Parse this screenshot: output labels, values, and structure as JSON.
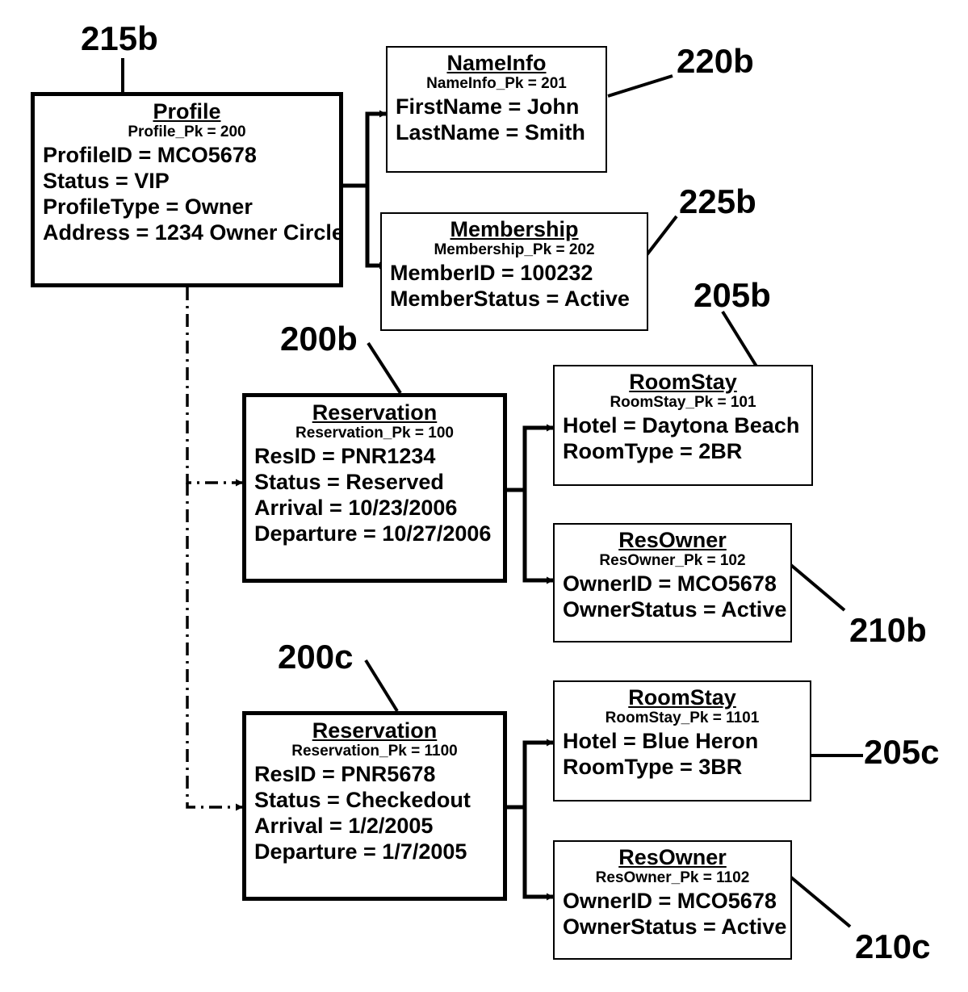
{
  "figure": {
    "type": "entity-relationship-object-diagram",
    "boxes": [
      {
        "id": "profile",
        "ref": "215b",
        "title": "Profile",
        "pk": "Profile_Pk = 200",
        "attrs": [
          "ProfileID = MCO5678",
          "Status = VIP",
          "ProfileType = Owner",
          "Address = 1234 Owner Circle"
        ]
      },
      {
        "id": "nameinfo",
        "ref": "220b",
        "title": "NameInfo",
        "pk": "NameInfo_Pk = 201",
        "attrs": [
          "FirstName = John",
          "LastName = Smith"
        ]
      },
      {
        "id": "membership",
        "ref": "225b",
        "title": "Membership",
        "pk": "Membership_Pk = 202",
        "attrs": [
          "MemberID = 100232",
          "MemberStatus = Active"
        ]
      },
      {
        "id": "reservation-b",
        "ref": "200b",
        "title": "Reservation",
        "pk": "Reservation_Pk = 100",
        "attrs": [
          "ResID = PNR1234",
          "Status = Reserved",
          "Arrival = 10/23/2006",
          "Departure = 10/27/2006"
        ]
      },
      {
        "id": "roomstay-b",
        "ref": "205b",
        "title": "RoomStay",
        "pk": "RoomStay_Pk = 101",
        "attrs": [
          "Hotel = Daytona Beach",
          "RoomType = 2BR"
        ]
      },
      {
        "id": "resowner-b",
        "ref": "210b",
        "title": "ResOwner",
        "pk": "ResOwner_Pk = 102",
        "attrs": [
          "OwnerID = MCO5678",
          "OwnerStatus = Active"
        ]
      },
      {
        "id": "reservation-c",
        "ref": "200c",
        "title": "Reservation",
        "pk": "Reservation_Pk = 1100",
        "attrs": [
          "ResID = PNR5678",
          "Status = Checkedout",
          "Arrival = 1/2/2005",
          "Departure = 1/7/2005"
        ]
      },
      {
        "id": "roomstay-c",
        "ref": "205c",
        "title": "RoomStay",
        "pk": "RoomStay_Pk = 1101",
        "attrs": [
          "Hotel = Blue Heron",
          "RoomType = 3BR"
        ]
      },
      {
        "id": "resowner-c",
        "ref": "210c",
        "title": "ResOwner",
        "pk": "ResOwner_Pk = 1102",
        "attrs": [
          "OwnerID = MCO5678",
          "OwnerStatus = Active"
        ]
      }
    ],
    "ref_labels": {
      "profile": "215b",
      "nameinfo": "220b",
      "membership": "225b",
      "reservation_b": "200b",
      "roomstay_b": "205b",
      "resowner_b": "210b",
      "reservation_c": "200c",
      "roomstay_c": "205c",
      "resowner_c": "210c"
    },
    "colors": {
      "line": "#000000",
      "background": "#ffffff"
    }
  }
}
